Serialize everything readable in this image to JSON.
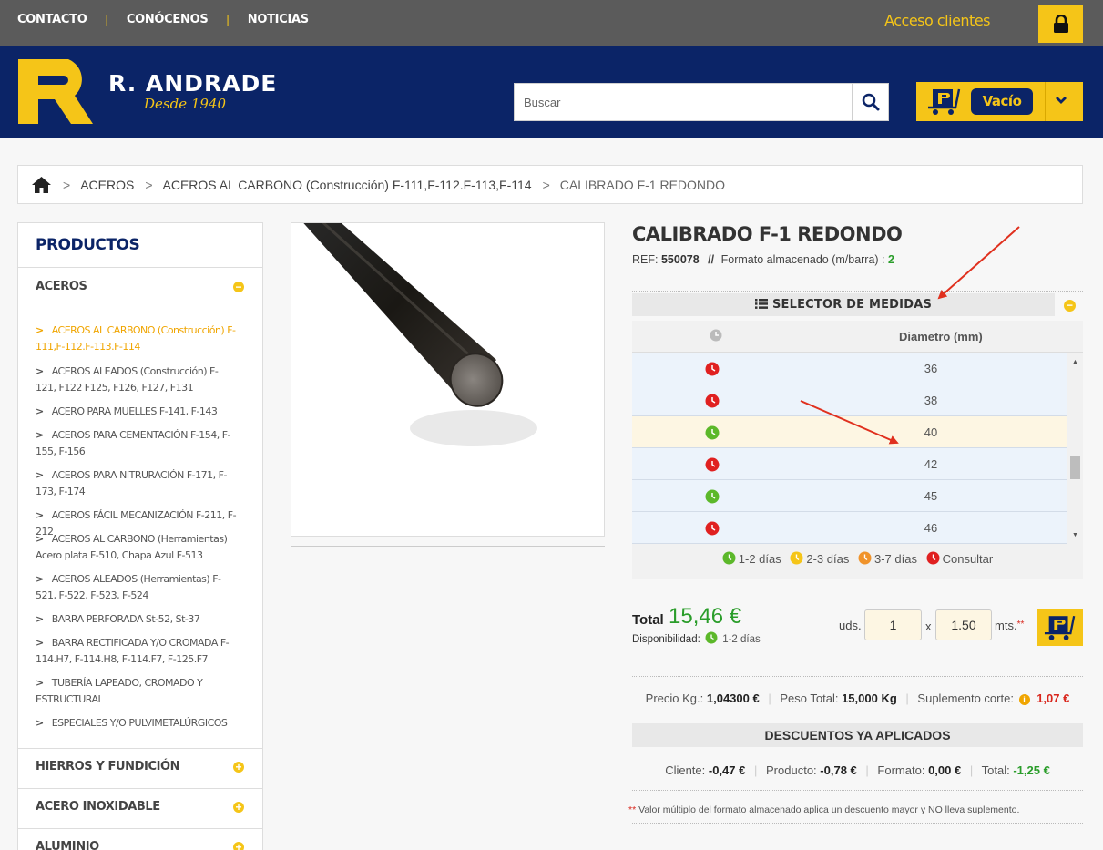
{
  "topbar": {
    "nav": [
      "CONTACTO",
      "CONÓCENOS",
      "NOTICIAS"
    ],
    "access_label": "Acceso clientes"
  },
  "header": {
    "brand": "R. ANDRADE",
    "slogan": "Desde 1940",
    "search_placeholder": "Buscar",
    "cart_label": "Vacío"
  },
  "breadcrumb": [
    "ACEROS",
    "ACEROS AL CARBONO (Construcción) F-111,F-112.F-113,F-114",
    "CALIBRADO F-1 REDONDO"
  ],
  "sidebar": {
    "title": "PRODUCTOS",
    "open_category": "ACEROS",
    "subitems": [
      {
        "label": "ACEROS AL CARBONO (Construcción) F-111,F-112.F-113.F-114",
        "active": true
      },
      {
        "label": "ACEROS ALEADOS (Construcción) F-121, F122 F125, F126, F127, F131",
        "active": false
      },
      {
        "label": "ACERO PARA MUELLES F-141, F-143",
        "active": false
      },
      {
        "label": "ACEROS PARA CEMENTACIÓN F-154, F-155, F-156",
        "active": false
      },
      {
        "label": "ACEROS PARA NITRURACIÓN F-171, F-173, F-174",
        "active": false
      },
      {
        "label": "ACEROS FÁCIL MECANIZACIÓN F-211, F-212",
        "active": false
      },
      {
        "label": "ACEROS AL CARBONO (Herramientas) Acero plata F-510, Chapa Azul F-513",
        "active": false
      },
      {
        "label": "ACEROS ALEADOS (Herramientas) F-521, F-522, F-523, F-524",
        "active": false
      },
      {
        "label": "BARRA PERFORADA St-52, St-37",
        "active": false
      },
      {
        "label": "BARRA RECTIFICADA Y/O CROMADA F-114.H7, F-114.H8, F-114.F7, F-125.F7",
        "active": false
      },
      {
        "label": "TUBERÍA LAPEADO, CROMADO Y ESTRUCTURAL",
        "active": false
      },
      {
        "label": "ESPECIALES Y/O PULVIMETALÚRGICOS",
        "active": false
      }
    ],
    "categories": [
      "HIERROS Y FUNDICIÓN",
      "ACERO INOXIDABLE",
      "ALUMINIO"
    ]
  },
  "product": {
    "title": "CALIBRADO F-1 REDONDO",
    "ref_label": "REF:",
    "ref_value": "550078",
    "format_label": "Formato almacenado (m/barra) :",
    "format_value": "2",
    "selector_label": "SELECTOR DE MEDIDAS",
    "column_header": "Diametro (mm)",
    "rows": [
      {
        "value": "36",
        "status": "red"
      },
      {
        "value": "38",
        "status": "red"
      },
      {
        "value": "40",
        "status": "green",
        "selected": true
      },
      {
        "value": "42",
        "status": "red"
      },
      {
        "value": "45",
        "status": "green"
      },
      {
        "value": "46",
        "status": "red"
      }
    ],
    "legend": [
      {
        "label": "1-2 días",
        "color": "#5cb82a"
      },
      {
        "label": "2-3 días",
        "color": "#f5c518"
      },
      {
        "label": "3-7 días",
        "color": "#f0932b"
      },
      {
        "label": "Consultar",
        "color": "#e02020"
      }
    ],
    "total_label": "Total",
    "total_value": "15,46 €",
    "availability_label": "Disponibilidad:",
    "availability_value": "1-2 días",
    "uds_label": "uds.",
    "qty_value": "1",
    "x_label": "x",
    "length_value": "1.50",
    "mts_label": "mts.",
    "mts_mark": "**",
    "precio_kg_label": "Precio Kg.:",
    "precio_kg_value": "1,04300 €",
    "peso_label": "Peso Total:",
    "peso_value": "15,000 Kg",
    "suplemento_label": "Suplemento corte:",
    "suplemento_value": "1,07 €",
    "descuentos_label": "DESCUENTOS YA APLICADOS",
    "cliente_label": "Cliente:",
    "cliente_value": "-0,47 €",
    "producto_label": "Producto:",
    "producto_value": "-0,78 €",
    "formato_label": "Formato:",
    "formato_value": "0,00 €",
    "total_desc_label": "Total:",
    "total_desc_value": "-1,25 €",
    "note_mark": "**",
    "note": "Valor múltiplo del formato almacenado aplica un descuento mayor y NO lleva suplemento."
  },
  "colors": {
    "navy": "#0b2467",
    "yellow": "#f5c518",
    "green": "#2a9d2a",
    "red": "#d9261c"
  }
}
